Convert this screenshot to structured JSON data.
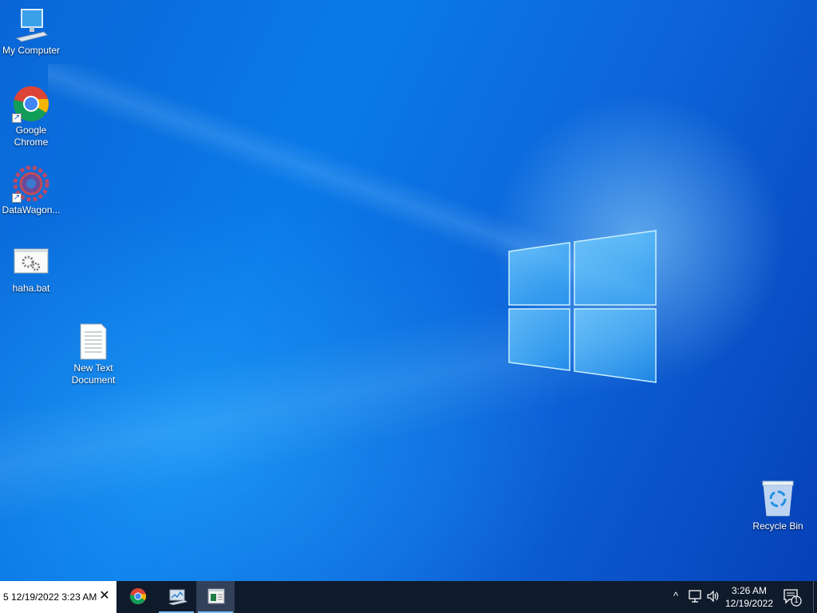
{
  "desktop": {
    "icons": [
      {
        "label": "My Computer",
        "icon": "monitor-icon"
      },
      {
        "label": "Google Chrome",
        "icon": "chrome-icon"
      },
      {
        "label": "DataWagon...",
        "icon": "datawagon-icon"
      },
      {
        "label": "haha.bat",
        "icon": "batch-file-icon"
      },
      {
        "label": "New Text Document",
        "icon": "text-document-icon"
      },
      {
        "label": "Recycle Bin",
        "icon": "recycle-bin-icon"
      }
    ]
  },
  "taskbar": {
    "notification_text": "5 12/19/2022 3:23 AM",
    "close_glyph": "✕",
    "apps": [
      {
        "name": "Google Chrome",
        "icon": "chrome-icon",
        "active": false
      },
      {
        "name": "Task Manager",
        "icon": "task-manager-icon",
        "active": false
      },
      {
        "name": "Spreadsheet",
        "icon": "spreadsheet-icon",
        "active": true
      }
    ],
    "tray": {
      "chevron": "^",
      "network_icon": "network-icon",
      "volume_icon": "volume-icon",
      "time": "3:26 AM",
      "date": "12/19/2022",
      "notification_count": "1"
    }
  },
  "colors": {
    "taskbar": "#0f1a2b",
    "accent": "#76b9ed",
    "wallpaper": "#0a7ae8"
  }
}
